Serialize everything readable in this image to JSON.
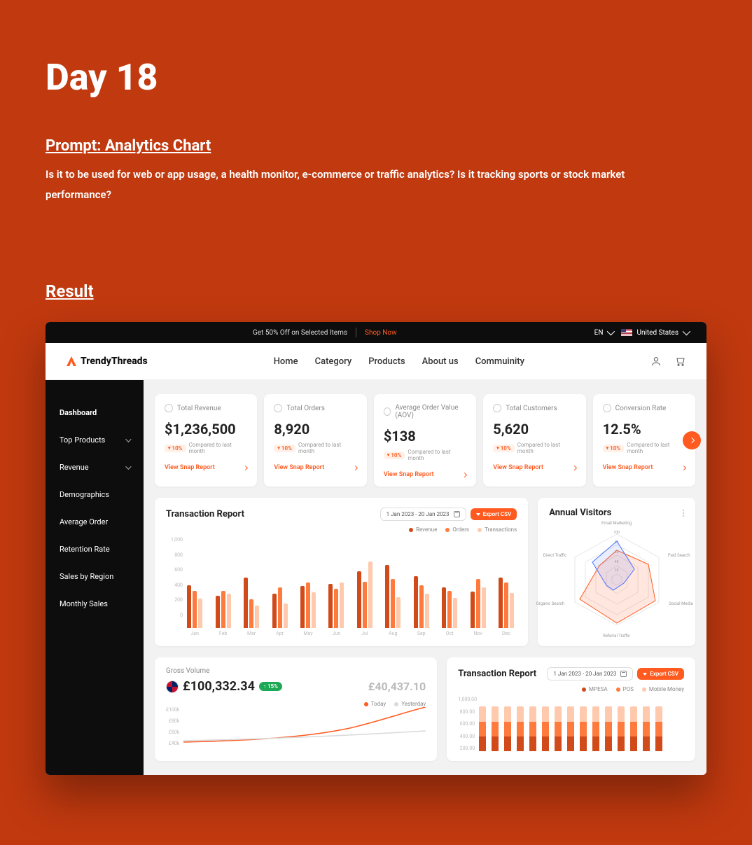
{
  "hero": {
    "title": "Day 18"
  },
  "prompt": {
    "heading": "Prompt: Analytics Chart",
    "body": "Is it to be used for web or app usage, a health monitor, e-commerce or traffic analytics? Is it tracking sports or stock market performance?"
  },
  "result": {
    "heading": "Result"
  },
  "topbar": {
    "promo": "Get 50% Off on Selected Items",
    "shop": "Shop Now",
    "lang": "EN",
    "country": "United States"
  },
  "brand": "TrendyThreads",
  "nav": [
    "Home",
    "Category",
    "Products",
    "About us",
    "Commuinity"
  ],
  "sidebar": [
    {
      "label": "Dashboard",
      "expandable": false
    },
    {
      "label": "Top Products",
      "expandable": true
    },
    {
      "label": "Revenue",
      "expandable": true
    },
    {
      "label": "Demographics",
      "expandable": false
    },
    {
      "label": "Average Order",
      "expandable": false
    },
    {
      "label": "Retention Rate",
      "expandable": false
    },
    {
      "label": "Sales by Region",
      "expandable": false
    },
    {
      "label": "Monthly Sales",
      "expandable": false
    }
  ],
  "cards": [
    {
      "title": "Total Revenue",
      "value": "$1,236,500",
      "delta": "10%",
      "compared": "Compared to last month",
      "link": "View Snap Report"
    },
    {
      "title": "Total Orders",
      "value": "8,920",
      "delta": "10%",
      "compared": "Compared to last month",
      "link": "View Snap Report"
    },
    {
      "title": "Average Order Value (AOV)",
      "value": "$138",
      "delta": "10%",
      "compared": "Compared to last month",
      "link": "View Snap Report"
    },
    {
      "title": "Total Customers",
      "value": "5,620",
      "delta": "10%",
      "compared": "Compared to last month",
      "link": "View Snap Report"
    },
    {
      "title": "Conversion Rate",
      "value": "12.5%",
      "delta": "10%",
      "compared": "Compared to last month",
      "link": "View Snap Report"
    }
  ],
  "transaction": {
    "title": "Transaction Report",
    "date": "1 Jan 2023 - 20 Jan 2023",
    "export": "Export CSV",
    "legend": [
      "Revenue",
      "Orders",
      "Transactions"
    ]
  },
  "visitors": {
    "title": "Annual Visitors",
    "labels": [
      "Email Marketing",
      "Paid Search",
      "Social Media",
      "Referral Traffic",
      "Organic Search",
      "Direct Traffic"
    ],
    "ticks": [
      "100",
      "80",
      "60",
      "40",
      "20"
    ]
  },
  "gross": {
    "label": "Gross Volume",
    "main": "£100,332.34",
    "delta": "↑ 15%",
    "sub": "£40,437.10",
    "legend": [
      "Today",
      "Yesterday"
    ],
    "y": [
      "£100k",
      "£80k",
      "£60k",
      "£40k"
    ]
  },
  "trans2": {
    "title": "Transaction Report",
    "date": "1 Jan 2023 - 20 Jan 2023",
    "export": "Export CSV",
    "legend": [
      "MPESA",
      "POS",
      "Mobile Money"
    ],
    "y": [
      "1,000.00",
      "800.00",
      "600.00",
      "400.00",
      "200.00"
    ]
  },
  "colors": {
    "revenue": "#d14a1a",
    "orders": "#ff7a3d",
    "trans": "#ffc9ad",
    "today": "#ff5a1f",
    "yesterday": "#d9d9d9",
    "mpesa": "#d14a1a",
    "pos": "#ff7a3d",
    "mobile": "#ffc9ad"
  },
  "chart_data": {
    "transaction_bars": {
      "type": "bar",
      "categories": [
        "Jan",
        "Feb",
        "Mar",
        "Apr",
        "May",
        "Jun",
        "Jul",
        "Aug",
        "Sep",
        "Oct",
        "Nov",
        "Dec"
      ],
      "ylim": [
        0,
        1000
      ],
      "y_ticks": [
        0,
        200,
        400,
        600,
        800,
        1000
      ],
      "series": [
        {
          "name": "Revenue",
          "color": "#d14a1a",
          "values": [
            530,
            400,
            620,
            420,
            520,
            540,
            700,
            780,
            640,
            500,
            450,
            620
          ]
        },
        {
          "name": "Orders",
          "color": "#ff7a3d",
          "values": [
            460,
            460,
            350,
            500,
            560,
            480,
            570,
            600,
            530,
            460,
            600,
            560
          ]
        },
        {
          "name": "Transactions",
          "color": "#ffc9ad",
          "values": [
            360,
            420,
            280,
            300,
            440,
            560,
            820,
            380,
            420,
            370,
            500,
            430
          ]
        }
      ]
    },
    "annual_visitors_radar": {
      "type": "radar",
      "axes": [
        "Email Marketing",
        "Paid Search",
        "Social Media",
        "Referral Traffic",
        "Organic Search",
        "Direct Traffic"
      ],
      "max": 100,
      "series": [
        {
          "name": "A",
          "color": "#ff5a1f",
          "values": [
            60,
            55,
            80,
            90,
            85,
            45
          ]
        },
        {
          "name": "B",
          "color": "#4a72ff",
          "values": [
            70,
            40,
            30,
            20,
            25,
            60
          ]
        }
      ]
    },
    "gross_volume_line": {
      "type": "line",
      "ylim": [
        0,
        100000
      ],
      "y_ticks_label": [
        "£100k",
        "£80k",
        "£60k",
        "£40k"
      ],
      "series": [
        {
          "name": "Today",
          "color": "#ff5a1f",
          "values": [
            8,
            10,
            12,
            15,
            18,
            22,
            28,
            36,
            50,
            70,
            95
          ]
        },
        {
          "name": "Yesterday",
          "color": "#d9d9d9",
          "values": [
            10,
            11,
            12,
            13,
            15,
            17,
            19,
            21,
            24,
            27,
            30
          ]
        }
      ]
    },
    "transaction_stacked": {
      "type": "bar",
      "stacked": true,
      "ylim": [
        0,
        1000
      ],
      "y_ticks": [
        "1,000.00",
        "800.00",
        "600.00",
        "400.00",
        "200.00"
      ],
      "bars": 15,
      "series": [
        {
          "name": "MPESA",
          "color": "#d14a1a",
          "portion": 0.33
        },
        {
          "name": "POS",
          "color": "#ff7a3d",
          "portion": 0.33
        },
        {
          "name": "Mobile Money",
          "color": "#ffc9ad",
          "portion": 0.34
        }
      ],
      "heights": [
        820,
        820,
        820,
        820,
        820,
        820,
        820,
        820,
        820,
        820,
        820,
        820,
        820,
        820,
        820
      ]
    }
  }
}
